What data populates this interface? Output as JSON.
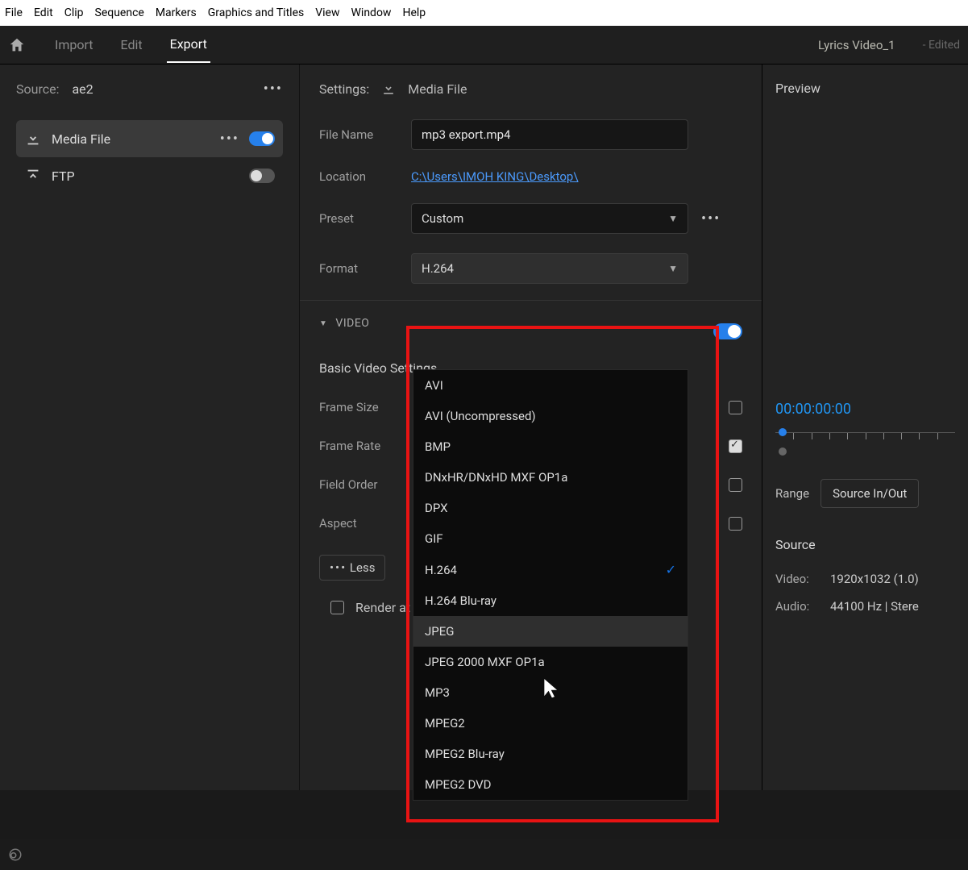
{
  "menubar": [
    "File",
    "Edit",
    "Clip",
    "Sequence",
    "Markers",
    "Graphics and Titles",
    "View",
    "Window",
    "Help"
  ],
  "tabs": {
    "import": "Import",
    "edit": "Edit",
    "export": "Export"
  },
  "document": {
    "title": "Lyrics Video_1",
    "status": "- Edited"
  },
  "source": {
    "label": "Source:",
    "value": "ae2"
  },
  "destinations": [
    {
      "id": "media-file",
      "label": "Media File",
      "enabled": true
    },
    {
      "id": "ftp",
      "label": "FTP",
      "enabled": false
    }
  ],
  "settings": {
    "header": "Settings:",
    "mediaFile": "Media File",
    "fields": {
      "fileName": {
        "label": "File Name",
        "value": "mp3 export.mp4"
      },
      "location": {
        "label": "Location",
        "value": "C:\\Users\\IMOH KING\\Desktop\\"
      },
      "preset": {
        "label": "Preset",
        "value": "Custom"
      },
      "format": {
        "label": "Format",
        "value": "H.264"
      }
    }
  },
  "formatOptions": [
    "AVI",
    "AVI (Uncompressed)",
    "BMP",
    "DNxHR/DNxHD MXF OP1a",
    "DPX",
    "GIF",
    "H.264",
    "H.264 Blu-ray",
    "JPEG",
    "JPEG 2000 MXF OP1a",
    "MP3",
    "MPEG2",
    "MPEG2 Blu-ray",
    "MPEG2 DVD"
  ],
  "formatSelected": "H.264",
  "formatHovered": "JPEG",
  "video": {
    "section": "VIDEO",
    "subhead": "Basic Video Settings",
    "frameSize": "Frame Size",
    "frameRate": "Frame Rate",
    "fieldOrder": "Field Order",
    "aspect": "Aspect",
    "less": "Less",
    "render": "Render at Max"
  },
  "preview": {
    "label": "Preview",
    "timecode": "00:00:00:00",
    "rangeLabel": "Range",
    "rangeValue": "Source In/Out",
    "source": {
      "title": "Source",
      "videoLabel": "Video:",
      "videoValue": "1920x1032 (1.0)",
      "audioLabel": "Audio:",
      "audioValue": "44100 Hz | Stere"
    }
  },
  "icons": {
    "dots": "•••"
  }
}
